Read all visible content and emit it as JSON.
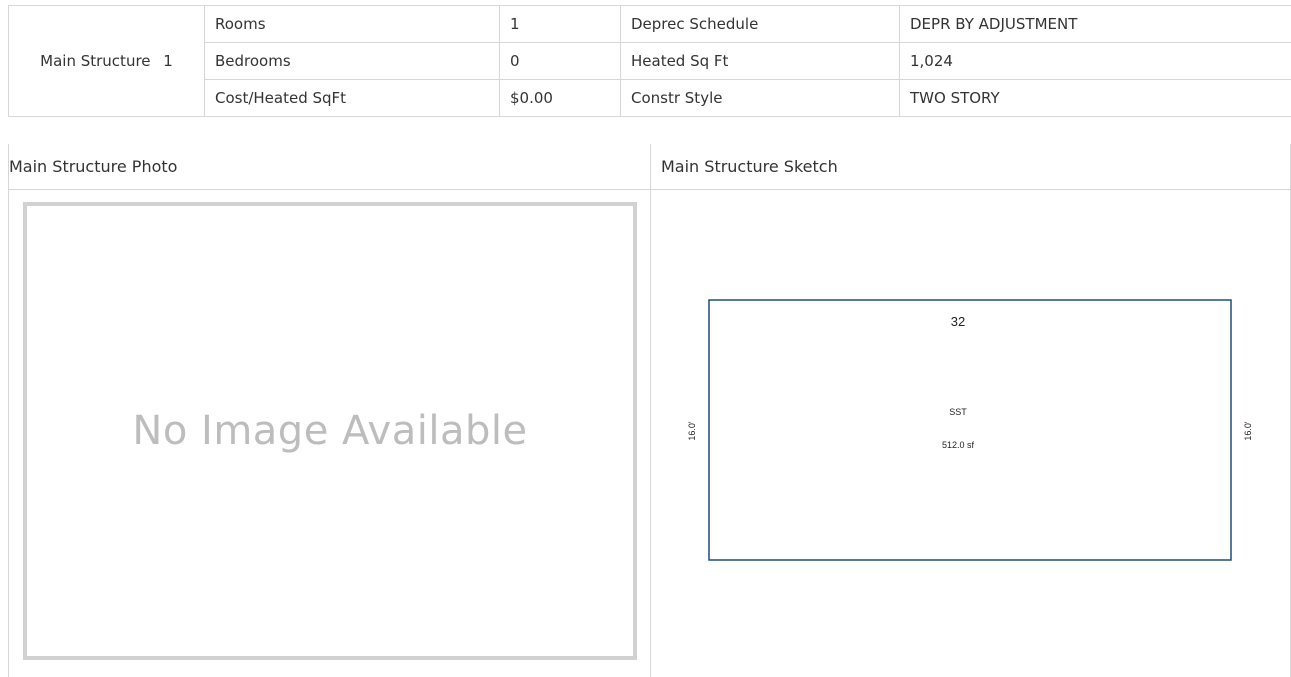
{
  "structure": {
    "label": "Main Structure",
    "number": "1",
    "rows": [
      {
        "label": "Rooms",
        "value": "1",
        "label2": "Deprec Schedule",
        "value2": "DEPR BY ADJUSTMENT"
      },
      {
        "label": "Bedrooms",
        "value": "0",
        "label2": "Heated Sq Ft",
        "value2": "1,024"
      },
      {
        "label": "Cost/Heated SqFt",
        "value": "$0.00",
        "label2": "Constr Style",
        "value2": "TWO STORY"
      }
    ]
  },
  "photo": {
    "title": "Main Structure Photo",
    "placeholder": "No Image Available"
  },
  "sketch": {
    "title": "Main Structure Sketch",
    "top_dim": "32",
    "left_dim": "16.0'",
    "right_dim": "16.0'",
    "area_code": "SST",
    "area": "512.0 sf",
    "outline_color": "#1f4e79"
  }
}
